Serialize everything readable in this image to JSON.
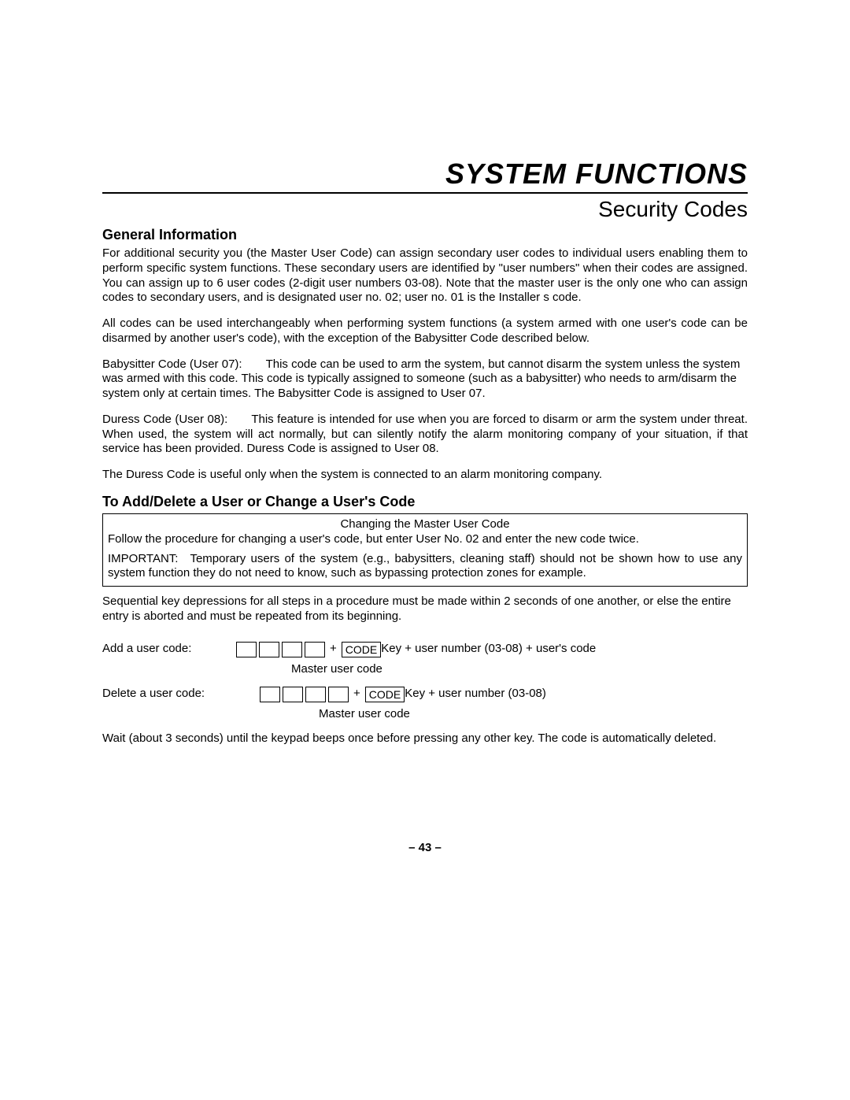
{
  "header": {
    "main_title": "SYSTEM FUNCTIONS",
    "sub_title": "Security Codes"
  },
  "section1": {
    "heading": "General Information",
    "p1": "For additional security you (the Master User Code) can assign secondary user codes to individual users enabling them to perform specific system functions. These secondary users are identified by \"user numbers\" when their codes are assigned. You can assign up to 6 user codes (2-digit user numbers 03-08). Note that the master user is the only one who can assign codes to secondary users, and is designated user no. 02; user no. 01 is the Installer s code.",
    "p2": "All codes can be used interchangeably when performing system functions (a system armed with one user's code can be disarmed by another user's code), with the exception of the Babysitter Code described below.",
    "p3": "Babysitter Code (User 07):  This code can be used to arm the system, but cannot disarm the system unless  the system was armed with this code. This code is typically assigned to someone (such as a babysitter) who needs to arm/disarm the system only at certain times. The Babysitter Code is assigned to User 07.",
    "p4": "Duress Code (User 08):  This feature is intended for use when you are forced to disarm or arm the system under threat. When used, the system will act normally, but can silently notify the alarm monitoring company of your situation, if that service has been provided. Duress Code is assigned to User 08.",
    "p5": "The Duress Code is useful only when the system is connected to an alarm monitoring company."
  },
  "section2": {
    "heading": "To Add/Delete a User or Change a User's Code",
    "box_title": "Changing the Master User Code",
    "box_p1": "Follow the procedure for changing a user's code, but enter User No. 02 and enter the new code twice.",
    "box_p2": "IMPORTANT: Temporary users of the system (e.g., babysitters, cleaning staff) should not be shown how to use any system function they do not need to know, such as bypassing protection zones for example.",
    "seq_note": "Sequential key depressions for all steps in a procedure must be made within 2 seconds of one another, or else the entire entry is aborted and must be repeated from its beginning.",
    "add_label": "Add a user code:",
    "delete_label": "Delete a user code:",
    "code_key": "CODE",
    "add_suffix": " Key + user number (03-08) + user's code",
    "delete_suffix": " Key + user number  (03-08)",
    "master_label": "Master user code",
    "wait_note": "Wait (about 3 seconds) until the keypad beeps once before pressing any other key. The code is automatically deleted."
  },
  "page_number": "– 43 –"
}
